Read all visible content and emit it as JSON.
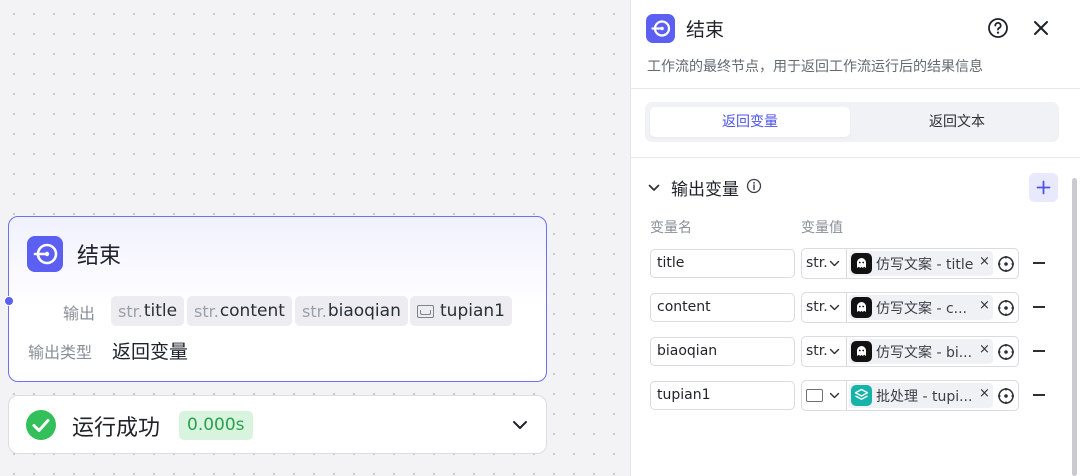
{
  "node": {
    "title": "结束",
    "output_label": "输出",
    "output_type_label": "输出类型",
    "output_type_value": "返回变量",
    "outputs": [
      {
        "prefix": "str.",
        "name": "title"
      },
      {
        "prefix": "str.",
        "name": "content"
      },
      {
        "prefix": "str.",
        "name": "biaoqian"
      },
      {
        "prefix": "",
        "name": "tupian1",
        "icon": "image-icon"
      }
    ]
  },
  "status": {
    "text": "运行成功",
    "time": "0.000s",
    "color": "#33c05a"
  },
  "panel": {
    "title": "结束",
    "description": "工作流的最终节点，用于返回工作流运行后的结果信息",
    "tabs": [
      "返回变量",
      "返回文本"
    ],
    "active_tab": "返回变量",
    "section_title": "输出变量",
    "col_name": "变量名",
    "col_value": "变量值",
    "variables": [
      {
        "name": "title",
        "type": "str.",
        "ref": "仿写文案 - title",
        "ref_icon": "ghost-app-icon"
      },
      {
        "name": "content",
        "type": "str.",
        "ref": "仿写文案 - c...",
        "ref_icon": "ghost-app-icon"
      },
      {
        "name": "biaoqian",
        "type": "str.",
        "ref": "仿写文案 - bi...",
        "ref_icon": "ghost-app-icon"
      },
      {
        "name": "tupian1",
        "type": "",
        "type_icon": "image-icon",
        "ref": "批处理 - tupi...",
        "ref_icon": "layers-icon"
      }
    ]
  },
  "colors": {
    "accent": "#5b5ff2",
    "accent_text": "#4d53e8",
    "success": "#33c05a",
    "success_bg": "#d8f4de"
  }
}
